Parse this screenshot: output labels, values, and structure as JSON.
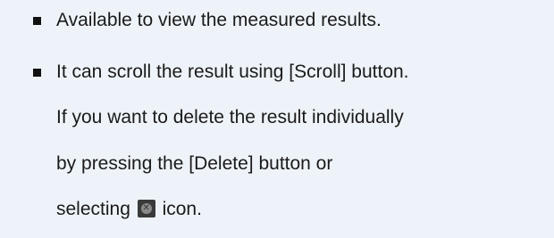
{
  "items": [
    {
      "lines": [
        "Available to view the measured results."
      ]
    },
    {
      "lines": [
        "It can scroll the result using [Scroll] button.",
        "If you want to delete the result individually",
        "by pressing the [Delete] button or"
      ],
      "last_line": {
        "before_icon": "selecting",
        "icon": "delete-x-icon",
        "after_icon": "icon."
      }
    }
  ]
}
